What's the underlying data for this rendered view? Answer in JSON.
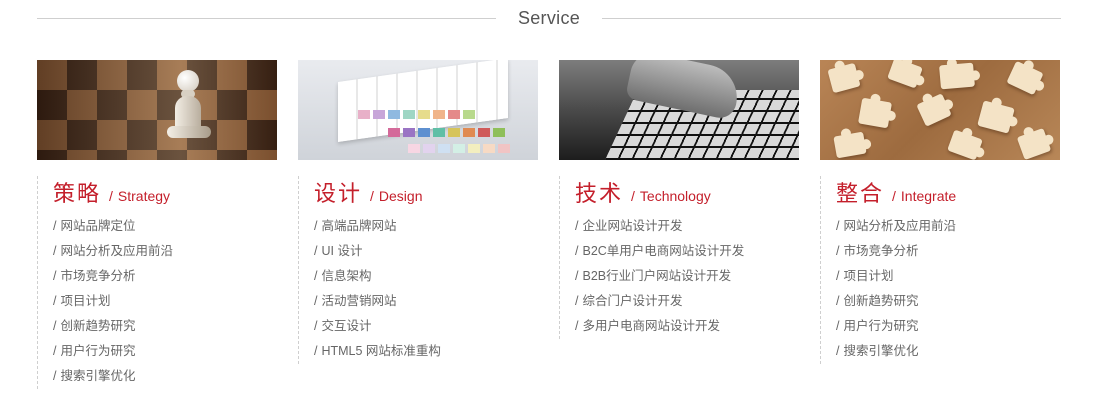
{
  "header": {
    "title": "Service"
  },
  "columns": [
    {
      "image": "chess-pawn-image",
      "title_cn": "策略",
      "separator": "/",
      "title_en": "Strategy",
      "items": [
        "网站品牌定位",
        "网站分析及应用前沿",
        "市场竞争分析",
        "项目计划",
        "创新趋势研究",
        "用户行为研究",
        "搜索引擎优化"
      ]
    },
    {
      "image": "color-swatches-image",
      "title_cn": "设计",
      "separator": "/",
      "title_en": "Design",
      "items": [
        "高端品牌网站",
        "UI 设计",
        "信息架构",
        "活动营销网站",
        "交互设计",
        "HTML5 网站标准重构"
      ]
    },
    {
      "image": "keyboard-typing-image",
      "title_cn": "技术",
      "separator": "/",
      "title_en": "Technology",
      "items": [
        "企业网站设计开发",
        "B2C单用户电商网站设计开发",
        "B2B行业门户网站设计开发",
        "综合门户设计开发",
        "多用户电商网站设计开发"
      ]
    },
    {
      "image": "puzzle-pieces-image",
      "title_cn": "整合",
      "separator": "/",
      "title_en": "Integrate",
      "items": [
        "网站分析及应用前沿",
        "市场竞争分析",
        "项目计划",
        "创新趋势研究",
        "用户行为研究",
        "搜索引擎优化"
      ]
    }
  ],
  "list_prefix": "/",
  "colors": {
    "accent": "#c41f2b",
    "text": "#666666",
    "divider": "#cfcfcf"
  }
}
